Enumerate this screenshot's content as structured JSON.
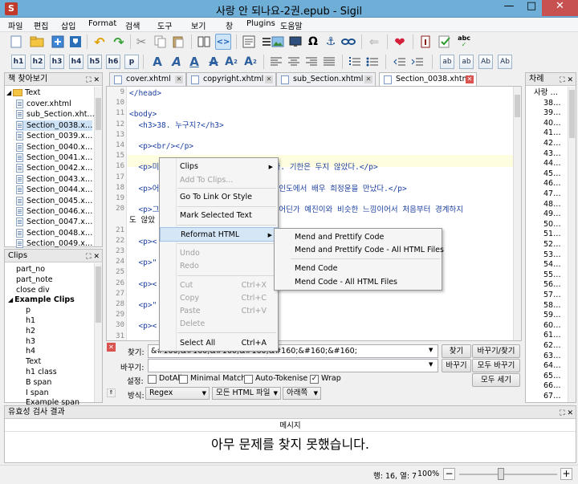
{
  "window": {
    "title": "사랑 안 되나요-2권.epub - Sigil",
    "app_icon": "S"
  },
  "menu": [
    "파일",
    "편집",
    "삽입",
    "Format",
    "검색",
    "도구",
    "보기",
    "창",
    "Plugins",
    "도움말"
  ],
  "heading_buttons": [
    "h1",
    "h2",
    "h3",
    "h4",
    "h5",
    "h6",
    "p"
  ],
  "misc_buttons": [
    "ab",
    "ab",
    "Ab",
    "Ab"
  ],
  "book_browser": {
    "title": "책 찾아보기",
    "folder": "Text",
    "files": [
      "cover.xhtml",
      "sub_Section.xht…",
      "Section_0038.x…",
      "Section_0039.x…",
      "Section_0040.x…",
      "Section_0041.x…",
      "Section_0042.x…",
      "Section_0043.x…",
      "Section_0044.x…",
      "Section_0045.x…",
      "Section_0046.x…",
      "Section_0047.x…",
      "Section_0048.x…",
      "Section_0049.x…"
    ]
  },
  "clips": {
    "title": "Clips",
    "items": [
      "part_no",
      "part_note",
      "close div"
    ],
    "group": "Example Clips",
    "group_items": [
      "p",
      "h1",
      "h2",
      "h3",
      "h4",
      "Text",
      "h1 class",
      "B span",
      "I span",
      "Example span"
    ]
  },
  "tabs": [
    "cover.xhtml",
    "copyright.xhtml",
    "sub_Section.xhtml",
    "Section_0038.xhtml"
  ],
  "code": [
    {
      "ln": "9",
      "text": "</head>"
    },
    {
      "ln": "10",
      "text": ""
    },
    {
      "ln": "11",
      "text": "<body>"
    },
    {
      "ln": "12",
      "text": "  <h3>38. 누구지?</h3>"
    },
    {
      "ln": "13",
      "text": ""
    },
    {
      "ln": "14",
      "text": "  <p><br/></p>"
    },
    {
      "ln": "15",
      "text": ""
    },
    {
      "ln": "16",
      "text": "  <p>미처준은 두 들은 다시 여행을 떠났다. 기한은 두지 않았다.</p>"
    },
    {
      "ln": "17",
      "text": ""
    },
    {
      "ln": "18",
      "text": "  <p>어                      녹은 인도에서 배우 희정윤을 만났다.</p>"
    },
    {
      "ln": "19",
      "text": ""
    },
    {
      "ln": "20",
      "text": "  <p>그                      였고 어딘가 예진이와 비슷한 느낌이어서 처음부터 경계하지"
    },
    {
      "ln": "",
      "text": "도 않았"
    },
    {
      "ln": "21",
      "text": ""
    },
    {
      "ln": "22",
      "text": "  <p><"
    },
    {
      "ln": "23",
      "text": ""
    },
    {
      "ln": "24",
      "text": "  <p>\""
    },
    {
      "ln": "25",
      "text": ""
    },
    {
      "ln": "26",
      "text": "  <p><"
    },
    {
      "ln": "27",
      "text": ""
    },
    {
      "ln": "28",
      "text": "  <p>\""
    },
    {
      "ln": "29",
      "text": ""
    },
    {
      "ln": "30",
      "text": "  <p><"
    },
    {
      "ln": "31",
      "text": ""
    },
    {
      "ln": "32",
      "text": "  <p>\"                      . 노숙은 너무 위험한데 믿을만한 사람으로 보이니까 며칠 같"
    },
    {
      "ln": "",
      "text": "이 지내                    </p>"
    }
  ],
  "context_menu": {
    "items": [
      {
        "label": "Clips",
        "disabled": false,
        "submenu": true
      },
      {
        "label": "Add To Clips...",
        "disabled": true
      },
      {
        "label": "Go To Link Or Style",
        "disabled": false
      },
      {
        "label": "Mark Selected Text",
        "disabled": false
      },
      {
        "label": "Reformat HTML",
        "disabled": false,
        "submenu": true
      },
      {
        "label": "Undo",
        "disabled": true
      },
      {
        "label": "Redo",
        "disabled": true
      },
      {
        "label": "Cut",
        "shortcut": "Ctrl+X",
        "disabled": true
      },
      {
        "label": "Copy",
        "shortcut": "Ctrl+C",
        "disabled": true
      },
      {
        "label": "Paste",
        "shortcut": "Ctrl+V",
        "disabled": true
      },
      {
        "label": "Delete",
        "disabled": true
      },
      {
        "label": "Select All",
        "shortcut": "Ctrl+A",
        "disabled": false
      }
    ],
    "submenu": [
      "Mend and Prettify Code",
      "Mend and Prettify Code - All HTML Files",
      "Mend Code",
      "Mend Code - All HTML Files"
    ]
  },
  "find": {
    "find_label": "찾기:",
    "find_value": "&#160;&#160;&#160;&#160;&#160;&#160;&#160;",
    "replace_label": "바꾸기:",
    "replace_value": "",
    "find_btn": "찾기",
    "replace_find_btn": "바꾸기/찾기",
    "replace_btn": "바꾸기",
    "replace_all_btn": "모두 바꾸기",
    "count_all_btn": "모두 세기",
    "settings_label": "설정:",
    "opts": [
      "DotAll",
      "Minimal Match",
      "Auto-Tokenise",
      "Wrap"
    ],
    "opts_checked": [
      false,
      false,
      false,
      true
    ],
    "mode_label": "방식:",
    "mode": "Regex",
    "scope": "모든 HTML 파일",
    "direction": "아래쪽"
  },
  "toc": {
    "title": "차례",
    "items": [
      "사랑 …",
      "38…",
      "39…",
      "40…",
      "41…",
      "42…",
      "43…",
      "44…",
      "45…",
      "46…",
      "47…",
      "48…",
      "49…",
      "50…",
      "51…",
      "52…",
      "53…",
      "54…",
      "55…",
      "56…",
      "57…",
      "58…",
      "59…",
      "60…",
      "61…",
      "62…",
      "63…",
      "64…",
      "65…",
      "66…",
      "67…"
    ]
  },
  "validation": {
    "title": "유효성 검사 결과",
    "column": "메시지",
    "message": "아무 문제를 찾지 못했습니다."
  },
  "status": {
    "position": "행: 16, 열: 7",
    "zoom": "100%"
  }
}
